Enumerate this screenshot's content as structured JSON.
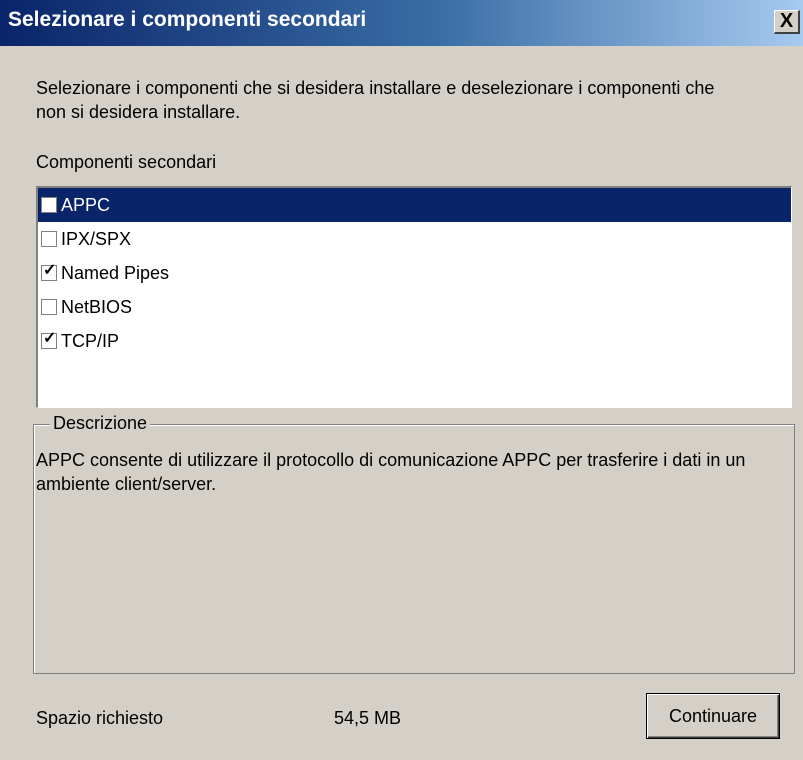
{
  "window": {
    "title": "Selezionare i componenti secondari",
    "close_label": "X"
  },
  "intro": "Selezionare i componenti che si desidera installare e deselezionare i componenti che non si desidera installare.",
  "list": {
    "label": "Componenti secondari",
    "items": [
      {
        "label": "APPC",
        "checked": false,
        "selected": true
      },
      {
        "label": "IPX/SPX",
        "checked": false,
        "selected": false
      },
      {
        "label": "Named Pipes",
        "checked": true,
        "selected": false
      },
      {
        "label": "NetBIOS",
        "checked": false,
        "selected": false
      },
      {
        "label": "TCP/IP",
        "checked": true,
        "selected": false
      }
    ]
  },
  "description": {
    "legend": "Descrizione",
    "text": "APPC consente di utilizzare il protocollo di comunicazione APPC per trasferire i dati in un ambiente client/server."
  },
  "footer": {
    "space_label": "Spazio richiesto",
    "space_value": "54,5 MB",
    "continue_label": "Continuare"
  },
  "colors": {
    "selection": "#0a246a",
    "dialog_bg": "#d4d0c8"
  }
}
